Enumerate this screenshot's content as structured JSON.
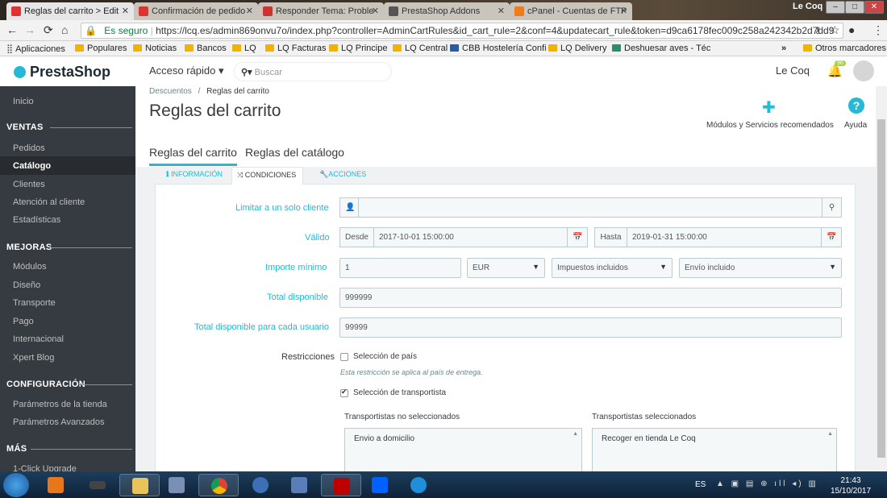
{
  "browser": {
    "tabs": [
      {
        "title": "Reglas del carrito > Edit",
        "active": true
      },
      {
        "title": "Confirmación de pedido",
        "active": false
      },
      {
        "title": "Responder Tema: Proble",
        "active": false
      },
      {
        "title": "PrestaShop Addons",
        "active": false
      },
      {
        "title": "cPanel - Cuentas de FTP",
        "active": false
      }
    ],
    "user": "Le Coq",
    "secure_label": "Es seguro",
    "url": "https://lcq.es/admin869onvu7o/index.php?controller=AdminCartRules&id_cart_rule=2&conf=4&updatecart_rule&token=d9ca6178fec009c258a242342b2d7dd9",
    "bookmarks": [
      "Aplicaciones",
      "Populares",
      "Noticias",
      "Bancos",
      "LQ",
      "LQ Facturas",
      "LQ Principe",
      "LQ Central",
      "CBB Hostelería Confi",
      "LQ Delivery",
      "Deshuesar aves - Téc",
      "»",
      "Otros marcadores"
    ]
  },
  "header": {
    "logo": "PrestaShop",
    "quick_access": "Acceso rápido ▾",
    "search_placeholder": "Buscar",
    "shop_name": "Le Coq",
    "notif_count": "96"
  },
  "sidebar": {
    "items": [
      "Inicio"
    ],
    "sections": [
      {
        "title": "VENTAS",
        "items": [
          "Pedidos",
          "Catálogo",
          "Clientes",
          "Atención al cliente",
          "Estadísticas"
        ]
      },
      {
        "title": "MEJORAS",
        "items": [
          "Módulos",
          "Diseño",
          "Transporte",
          "Pago",
          "Internacional",
          "Xpert Blog"
        ]
      },
      {
        "title": "CONFIGURACIÓN",
        "items": [
          "Parámetros de la tienda",
          "Parámetros Avanzados"
        ]
      },
      {
        "title": "MÁS",
        "items": [
          "1-Click Upgrade"
        ]
      }
    ],
    "active": "Catálogo"
  },
  "page": {
    "breadcrumb_parent": "Descuentos",
    "breadcrumb_sep": "/",
    "breadcrumb_current": "Reglas del carrito",
    "title": "Reglas del carrito",
    "modules_label": "Módulos y Servicios recomendados",
    "help_label": "Ayuda",
    "subtabs": [
      "Reglas del carrito",
      "Reglas del catálogo"
    ]
  },
  "form": {
    "tabs": [
      "INFORMACIÓN",
      "CONDICIONES",
      "ACCIONES"
    ],
    "limit_label": "Limitar a un solo cliente",
    "limit_value": "",
    "valid_label": "Válido",
    "from_label": "Desde",
    "from_value": "2017-10-01 15:00:00",
    "to_label": "Hasta",
    "to_value": "2019-01-31 15:00:00",
    "min_amount_label": "Importe mínimo",
    "min_amount_value": "1",
    "currency": "EUR",
    "tax": "Impuestos incluidos",
    "shipping": "Envío incluido",
    "total_label": "Total disponible",
    "total_value": "999999",
    "per_user_label": "Total disponible para cada usuario",
    "per_user_value": "99999",
    "restrictions_label": "Restricciones",
    "country_restriction": "Selección de país",
    "country_hint": "Esta restricción se aplica al país de entrega.",
    "carrier_restriction": "Selección de transportista",
    "unselected_title": "Transportistas no seleccionados",
    "selected_title": "Transportistas seleccionados",
    "unselected_items": [
      "Envio a domicilio"
    ],
    "selected_items": [
      "Recoger en tienda Le Coq"
    ]
  },
  "taskbar": {
    "lang": "ES",
    "time": "21:43",
    "date": "15/10/2017"
  }
}
